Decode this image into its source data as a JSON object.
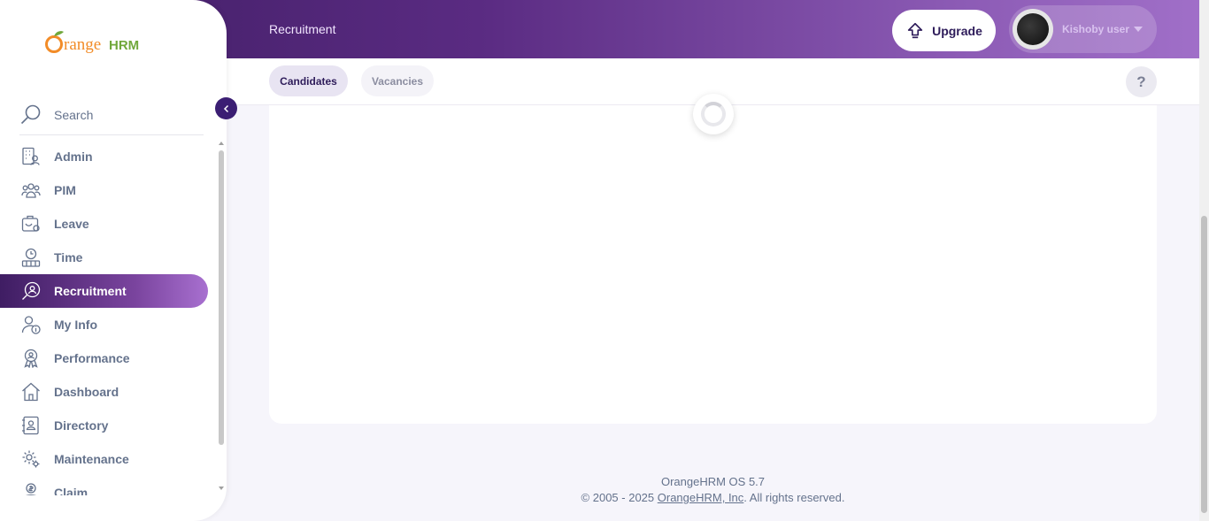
{
  "brand": {
    "logo_text_orange": "Orange",
    "logo_text_hrm": "HRM",
    "logo_colors": {
      "orange": "#f28c28",
      "green": "#70a83b"
    }
  },
  "header": {
    "page_title": "Recruitment",
    "upgrade_label": "Upgrade",
    "user_name": "Kishoby user"
  },
  "subnav": {
    "tabs": [
      {
        "label": "Candidates",
        "active": true
      },
      {
        "label": "Vacancies",
        "active": false
      }
    ],
    "help_label": "?"
  },
  "sidebar": {
    "search_placeholder": "Search",
    "items": [
      {
        "label": "Admin",
        "icon": "admin-icon"
      },
      {
        "label": "PIM",
        "icon": "pim-icon"
      },
      {
        "label": "Leave",
        "icon": "leave-icon"
      },
      {
        "label": "Time",
        "icon": "time-icon"
      },
      {
        "label": "Recruitment",
        "icon": "recruitment-icon",
        "active": true
      },
      {
        "label": "My Info",
        "icon": "my-info-icon"
      },
      {
        "label": "Performance",
        "icon": "performance-icon"
      },
      {
        "label": "Dashboard",
        "icon": "dashboard-icon"
      },
      {
        "label": "Directory",
        "icon": "directory-icon"
      },
      {
        "label": "Maintenance",
        "icon": "maintenance-icon"
      },
      {
        "label": "Claim",
        "icon": "claim-icon"
      }
    ]
  },
  "footer": {
    "version": "OrangeHRM OS 5.7",
    "copyright_prefix": "© 2005 - 2025 ",
    "company_link": "OrangeHRM, Inc",
    "copyright_suffix": ". All rights reserved."
  },
  "colors": {
    "accent": "#3f1d63",
    "accent_light": "#a070c8",
    "text": "#64728c"
  }
}
